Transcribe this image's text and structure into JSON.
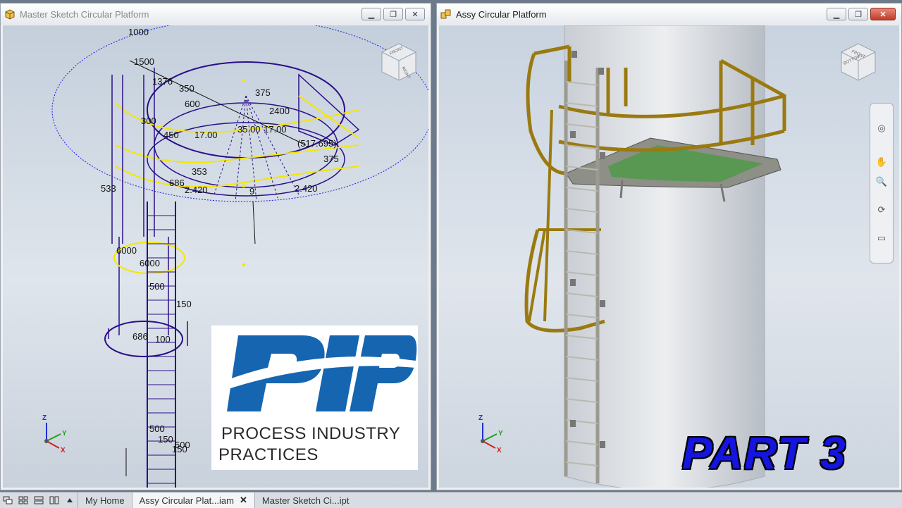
{
  "windows": {
    "left": {
      "title": "Master Sketch Circular Platform",
      "dimensions": [
        "1000",
        "1500",
        "1376",
        "350",
        "600",
        "375",
        "2400",
        "35.00",
        "17.00",
        "17.00",
        "(517.695)",
        "375",
        "300",
        "450",
        "533",
        "686",
        "2.420",
        "2.420",
        "353",
        "9",
        "6000",
        "6000",
        "500",
        "150",
        "686",
        "100",
        "500",
        "150",
        "500",
        "150"
      ]
    },
    "right": {
      "title": "Assy Circular Platform"
    }
  },
  "viewcube": {
    "top_label": "FRONT",
    "side_label": "RIGHT",
    "bottom_label": "BOTTOM"
  },
  "triad": {
    "z": "Z",
    "y": "Y",
    "x": "X"
  },
  "navbar": {
    "icons": [
      "steering-wheel-icon",
      "pan-hand-icon",
      "zoom-icon",
      "orbit-icon",
      "look-at-icon"
    ]
  },
  "logo": {
    "letters": "PIP",
    "line1": "PROCESS INDUSTRY",
    "line2": "PRACTICES"
  },
  "overlay_label": "PART 3",
  "taskbar": {
    "tabs": [
      {
        "label": "My Home"
      },
      {
        "label": "Assy Circular Plat...iam",
        "close": "✕"
      },
      {
        "label": "Master Sketch Ci...ipt"
      }
    ]
  },
  "colors": {
    "sketch": "#2a0f8a",
    "highlight": "#f5e600",
    "railing": "#9a7a10",
    "ladder": "#9a9a90",
    "logo_blue": "#1565b0",
    "part_label": "#1515e0"
  }
}
